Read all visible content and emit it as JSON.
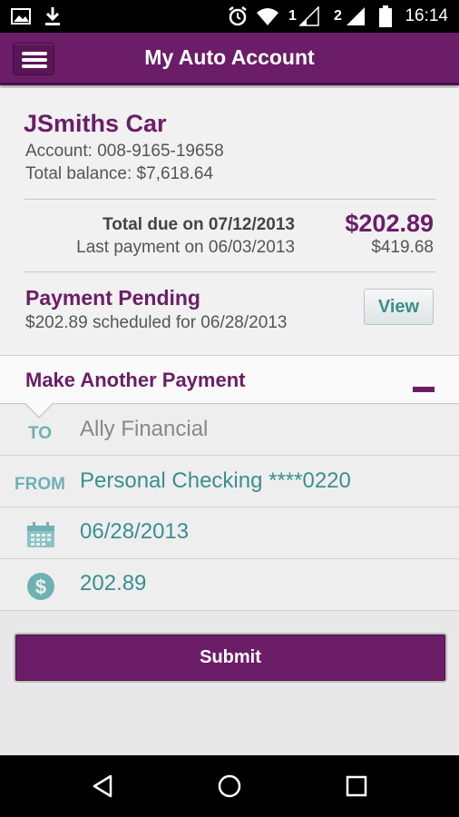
{
  "status_bar": {
    "time": "16:14",
    "sim1_label": "1",
    "sim2_label": "2",
    "icons": [
      "image-icon",
      "download-icon",
      "alarm-icon",
      "wifi-icon",
      "signal-icon",
      "signal-icon",
      "battery-icon"
    ]
  },
  "app_bar": {
    "title": "My Auto Account",
    "menu_icon": "hamburger-menu-icon"
  },
  "account": {
    "name": "JSmiths Car",
    "account_line": "Account: 008-9165-19658",
    "balance_line": "Total balance: $7,618.64",
    "total_due_label": "Total due on 07/12/2013",
    "total_due_amount": "$202.89",
    "last_payment_label": "Last payment on 06/03/2013",
    "last_payment_amount": "$419.68"
  },
  "pending": {
    "title": "Payment Pending",
    "detail": "$202.89 scheduled for 06/28/2013",
    "view_label": "View"
  },
  "make_payment": {
    "title": "Make Another Payment",
    "collapse_icon": "minus-icon"
  },
  "form": {
    "to_label": "TO",
    "to_value": "Ally Financial",
    "from_label": "FROM",
    "from_value": "Personal Checking ****0220",
    "date_icon": "calendar-icon",
    "date_value": "06/28/2013",
    "amount_icon": "dollar-icon",
    "amount_value": "202.89"
  },
  "submit_label": "Submit",
  "colors": {
    "brand_purple": "#6b1d68",
    "teal": "#3a8f90",
    "teal_light": "#6fb1b3"
  },
  "nav": [
    "back-icon",
    "home-icon",
    "recents-icon"
  ]
}
